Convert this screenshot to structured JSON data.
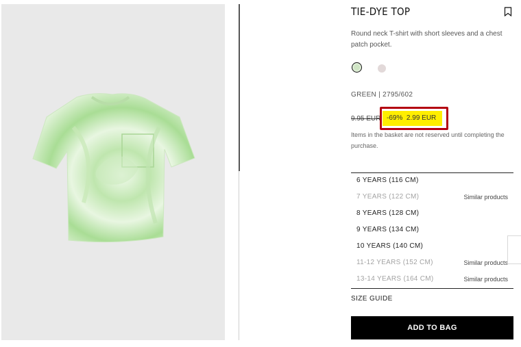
{
  "product": {
    "title": "TIE-DYE TOP",
    "description": "Round neck T-shirt with short sleeves and a chest patch pocket.",
    "color_ref": "GREEN | 2795/602",
    "colors": [
      {
        "name": "green",
        "hex": "#cfe5c4",
        "selected": true
      },
      {
        "name": "pink",
        "hex": "#e2d9d9",
        "selected": false
      }
    ]
  },
  "pricing": {
    "old_price": "9.95 EUR",
    "discount": "-69%",
    "new_price": "2.99 EUR",
    "highlight_color": "#ffee00",
    "annotation_color": "#b30010",
    "basket_note": "Items in the basket are not reserved until completing the purchase."
  },
  "sizes": [
    {
      "label": "6 YEARS (116 CM)",
      "available": true,
      "similar": ""
    },
    {
      "label": "7 YEARS (122 CM)",
      "available": false,
      "similar": "Similar products"
    },
    {
      "label": "8 YEARS (128 CM)",
      "available": true,
      "similar": ""
    },
    {
      "label": "9 YEARS (134 CM)",
      "available": true,
      "similar": ""
    },
    {
      "label": "10 YEARS (140 CM)",
      "available": true,
      "similar": ""
    },
    {
      "label": "11-12 YEARS (152 CM)",
      "available": false,
      "similar": "Similar products"
    },
    {
      "label": "13-14 YEARS (164 CM)",
      "available": false,
      "similar": "Similar products"
    }
  ],
  "actions": {
    "size_guide": "SIZE GUIDE",
    "add_to_bag": "ADD TO BAG"
  },
  "icons": {
    "bookmark": "bookmark-icon"
  }
}
